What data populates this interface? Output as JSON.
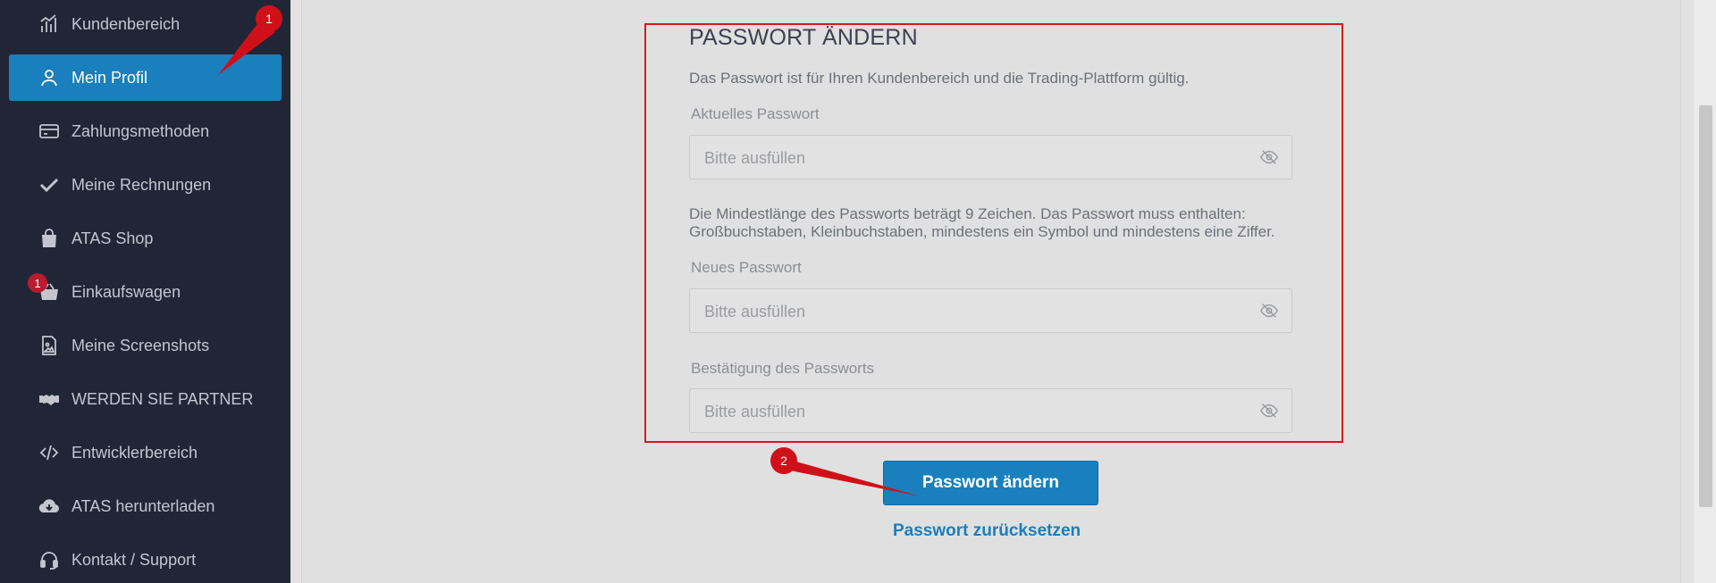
{
  "sidebar": {
    "items": [
      {
        "label": "Kundenbereich",
        "icon": "chart-bars-icon"
      },
      {
        "label": "Mein Profil",
        "icon": "user-icon",
        "active": true
      },
      {
        "label": "Zahlungsmethoden",
        "icon": "credit-card-icon"
      },
      {
        "label": "Meine Rechnungen",
        "icon": "checkmark-icon"
      },
      {
        "label": "ATAS Shop",
        "icon": "shopping-bag-icon"
      },
      {
        "label": "Einkaufswagen",
        "icon": "basket-icon"
      },
      {
        "label": "Meine Screenshots",
        "icon": "image-file-icon"
      },
      {
        "label": "WERDEN SIE PARTNER",
        "icon": "handshake-icon"
      },
      {
        "label": "Entwicklerbereich",
        "icon": "code-icon"
      },
      {
        "label": "ATAS herunterladen",
        "icon": "cloud-download-icon"
      },
      {
        "label": "Kontakt / Support",
        "icon": "headset-icon"
      }
    ],
    "cart_count": "1"
  },
  "password_section": {
    "title": "PASSWORT ÄNDERN",
    "description": "Das Passwort ist für Ihren Kundenbereich und die Trading-Plattform gültig.",
    "current_label": "Aktuelles Passwort",
    "placeholder": "Bitte ausfüllen",
    "requirements_line1": "Die Mindestlänge des Passworts beträgt 9 Zeichen. Das Passwort muss enthalten:",
    "requirements_line2": "Großbuchstaben, Kleinbuchstaben, mindestens ein Symbol und mindestens eine Ziffer.",
    "new_label": "Neues Passwort",
    "confirm_label": "Bestätigung des Passworts",
    "submit_label": "Passwort ändern",
    "reset_link": "Passwort zurücksetzen"
  },
  "annotations": {
    "badge1": "1",
    "badge2": "2"
  },
  "colors": {
    "sidebar_bg": "#212637",
    "accent": "#1a7fbd",
    "highlight_border": "#d11b1b",
    "annotation": "#d01019"
  }
}
